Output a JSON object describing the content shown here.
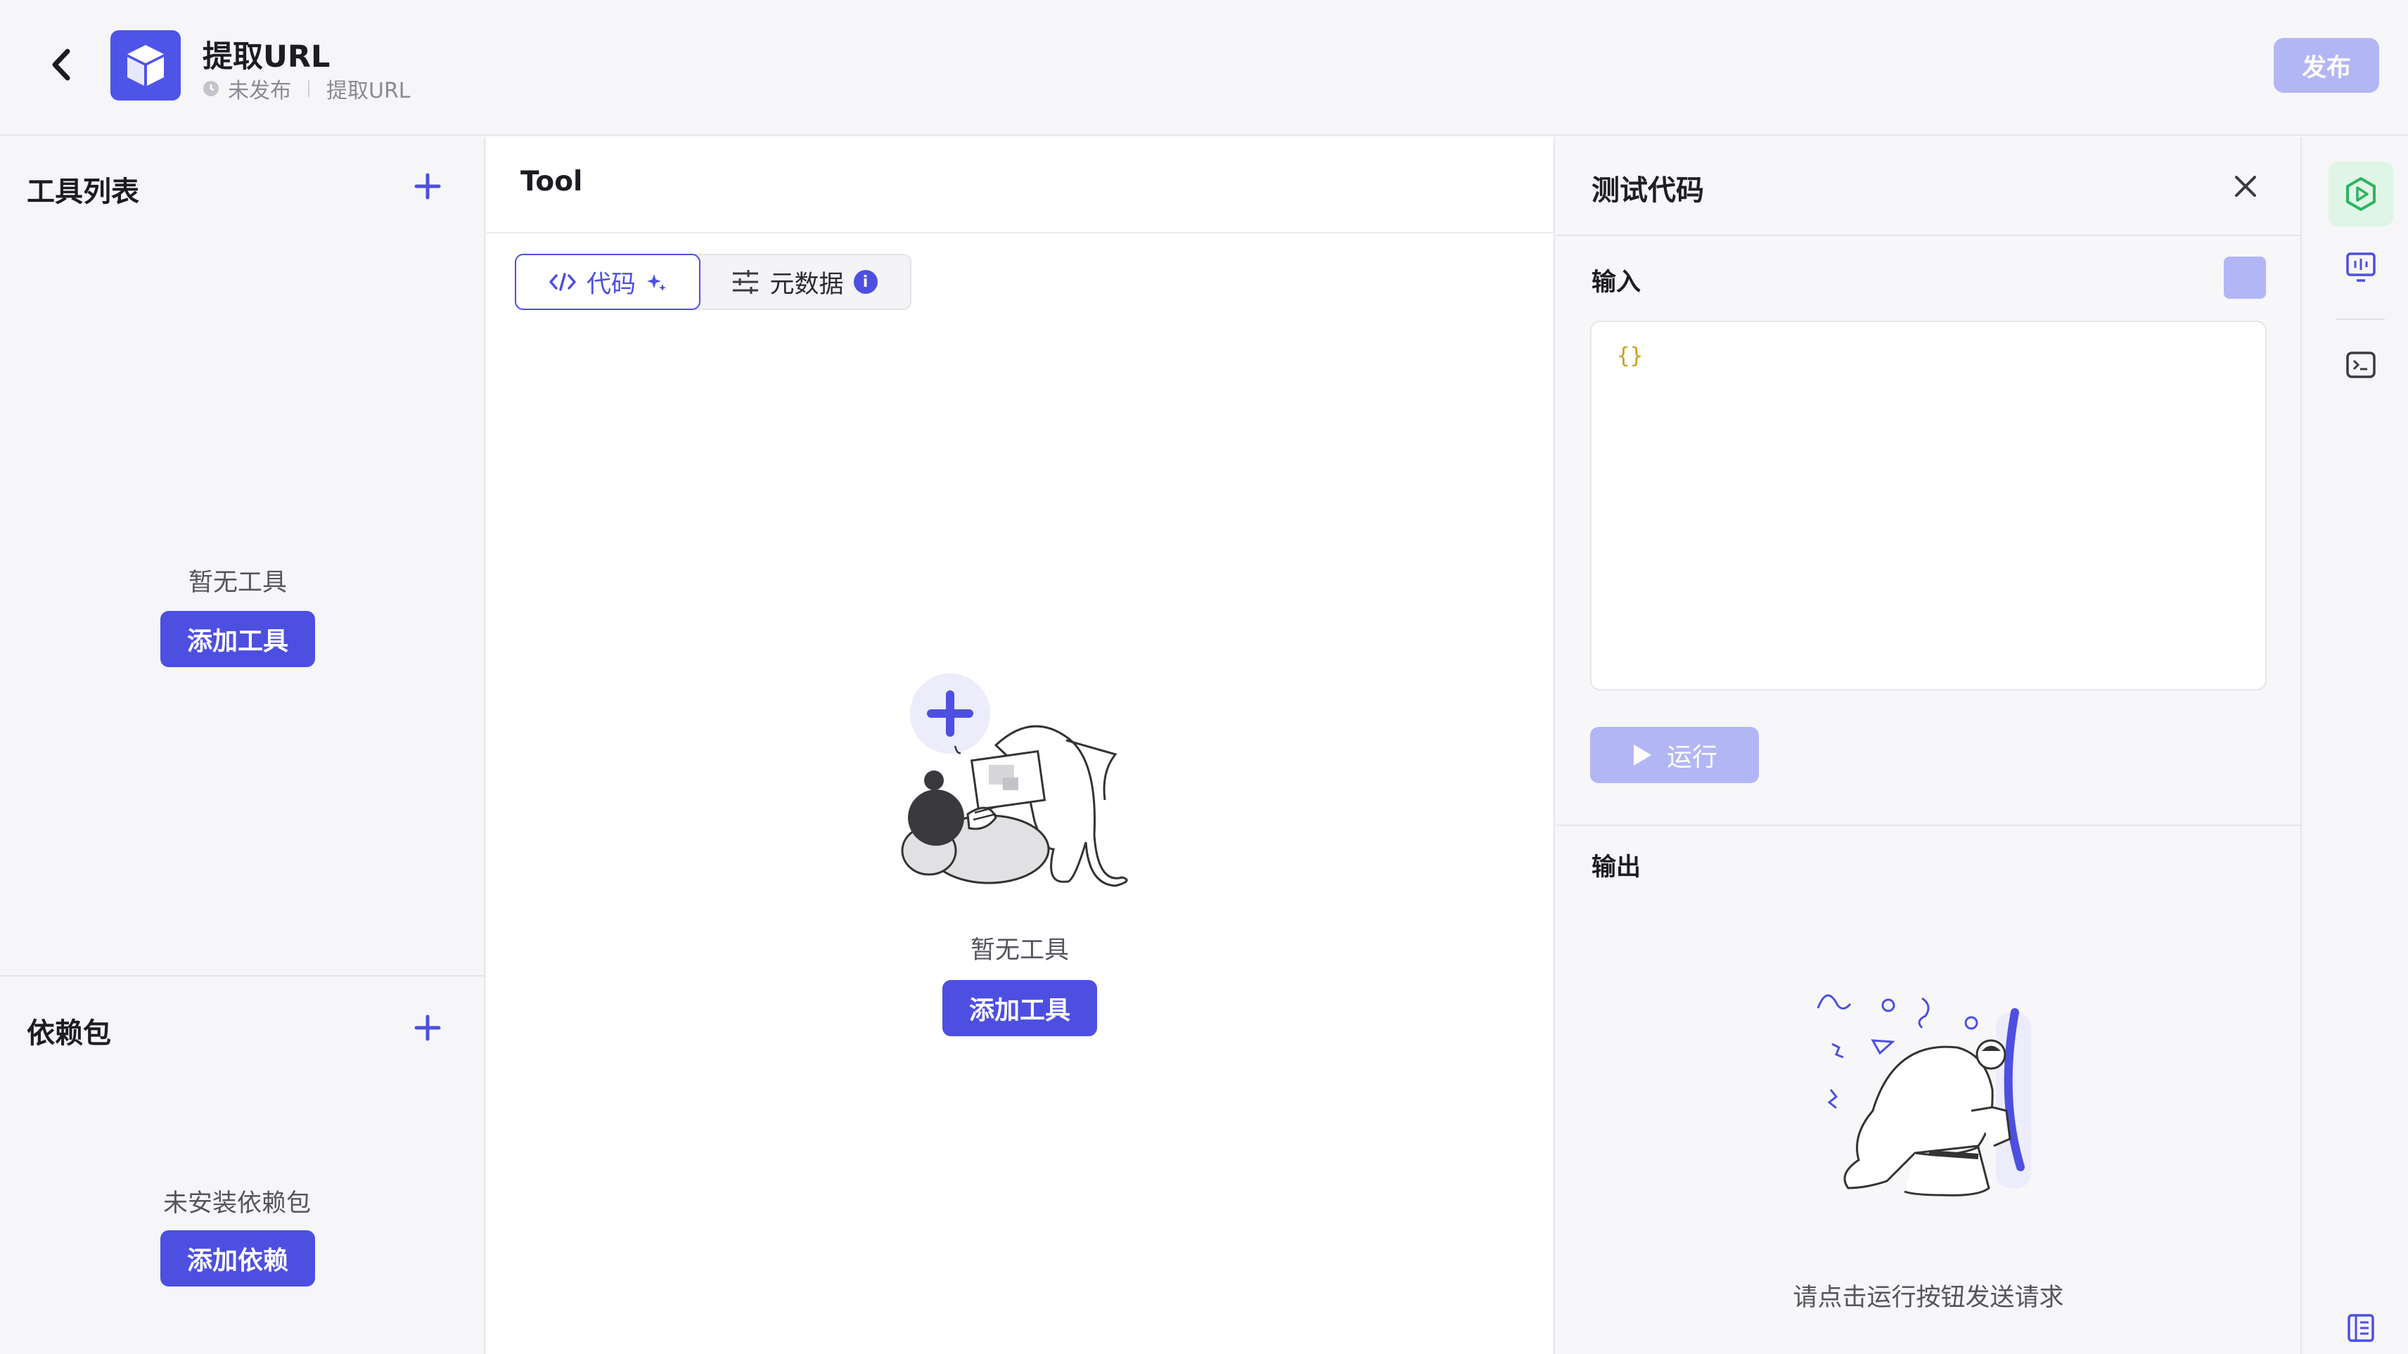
{
  "header": {
    "title": "提取URL",
    "status": "未发布",
    "breadcrumb": "提取URL",
    "publish_label": "发布"
  },
  "left": {
    "tools_title": "工具列表",
    "tools_empty": "暂无工具",
    "tools_add": "添加工具",
    "deps_title": "依赖包",
    "deps_empty": "未安装依赖包",
    "deps_add": "添加依赖"
  },
  "center": {
    "title": "Tool",
    "tab_code": "代码",
    "tab_meta": "元数据",
    "info_badge": "i",
    "empty_text": "暂无工具",
    "add_label": "添加工具"
  },
  "test": {
    "title": "测试代码",
    "input_label": "输入",
    "input_value": "{}",
    "run_label": "运行",
    "output_label": "输出",
    "output_hint": "请点击运行按钮发送请求"
  },
  "colors": {
    "accent": "#4d4fe0",
    "accent_disabled": "#b3b6f5",
    "rail_active": "#dff6e6",
    "json_brace": "#c9a227"
  },
  "icons": {
    "back": "chevron-left-icon",
    "logo": "cube-icon",
    "clock": "clock-icon",
    "add": "plus-icon",
    "code": "code-icon",
    "sparkle": "sparkle-icon",
    "sliders": "sliders-icon",
    "close": "close-icon",
    "play": "play-icon",
    "rail": [
      "play-circle-icon",
      "monitor-icon",
      "terminal-icon",
      "book-icon"
    ]
  }
}
